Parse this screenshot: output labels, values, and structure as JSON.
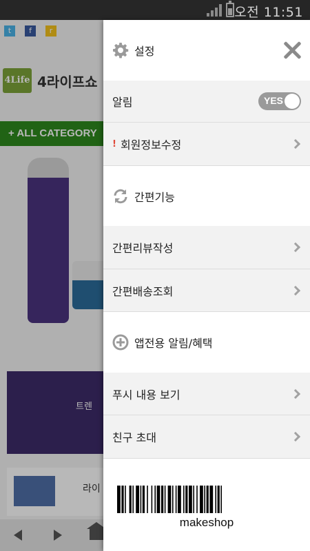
{
  "status_bar": {
    "time": "오전 11:51"
  },
  "background_site": {
    "social": [
      "t",
      "f",
      "r"
    ],
    "logo_mark": "4Life",
    "logo_text": "4라이프쇼",
    "category_bar": "+ ALL CATEGORY",
    "banner_text": "트렌",
    "card_text": "라이"
  },
  "drawer": {
    "header_title": "설정",
    "notification": {
      "label": "알림",
      "toggle_value": "YES"
    },
    "member_edit": {
      "alert_mark": "!",
      "label": "회원정보수정"
    },
    "quick_section": {
      "title": "간편기능"
    },
    "quick_items": [
      "간편리뷰작성",
      "간편배송조회"
    ],
    "app_section": {
      "title": "앱전용 알림/혜택"
    },
    "app_items": [
      "푸시 내용 보기",
      "친구 초대"
    ],
    "barcode_text": "makeshop"
  }
}
